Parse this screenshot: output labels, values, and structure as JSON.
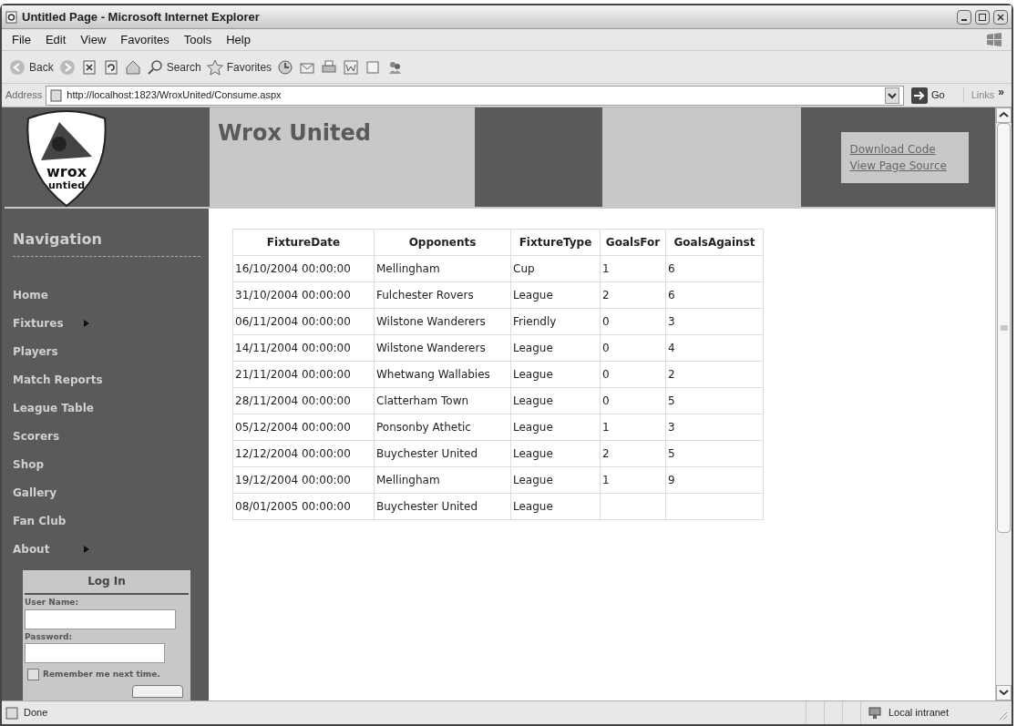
{
  "window": {
    "title": "Untitled Page - Microsoft Internet Explorer"
  },
  "menu": [
    "File",
    "Edit",
    "View",
    "Favorites",
    "Tools",
    "Help"
  ],
  "toolbar": [
    {
      "kind": "back",
      "label": "Back"
    },
    {
      "kind": "forward"
    },
    {
      "kind": "stop"
    },
    {
      "kind": "refresh"
    },
    {
      "kind": "home"
    },
    {
      "kind": "search",
      "label": "Search"
    },
    {
      "kind": "favorites",
      "label": "Favorites"
    },
    {
      "kind": "history"
    },
    {
      "kind": "mail"
    },
    {
      "kind": "print"
    },
    {
      "kind": "edit"
    },
    {
      "kind": "discuss"
    },
    {
      "kind": "messenger"
    }
  ],
  "address_bar": {
    "label": "Address",
    "url": "http://localhost:1823/WroxUnited/Consume.aspx",
    "go": "Go",
    "links": "Links",
    "more": "»"
  },
  "header": {
    "logo_text": [
      "wrox",
      "untied"
    ],
    "site_title": "Wrox United",
    "links": [
      "Download Code",
      "View Page Source"
    ]
  },
  "sidebar": {
    "heading": "Navigation",
    "items": [
      {
        "label": "Home",
        "has_submenu": false
      },
      {
        "label": "Fixtures",
        "has_submenu": true
      },
      {
        "label": "Players",
        "has_submenu": false
      },
      {
        "label": "Match Reports",
        "has_submenu": false
      },
      {
        "label": "League Table",
        "has_submenu": false
      },
      {
        "label": "Scorers",
        "has_submenu": false
      },
      {
        "label": "Shop",
        "has_submenu": false
      },
      {
        "label": "Gallery",
        "has_submenu": false
      },
      {
        "label": "Fan Club",
        "has_submenu": false
      },
      {
        "label": "About",
        "has_submenu": true
      }
    ]
  },
  "login": {
    "title": "Log In",
    "fields": [
      {
        "label": "User Name:"
      },
      {
        "label": "Password:"
      }
    ],
    "remember": {
      "label": "Remember me next time.",
      "checked": false
    }
  },
  "table": {
    "columns": [
      "FixtureDate",
      "Opponents",
      "FixtureType",
      "GoalsFor",
      "GoalsAgainst"
    ],
    "rows": [
      [
        "16/10/2004 00:00:00",
        "Mellingham",
        "Cup",
        "1",
        "6"
      ],
      [
        "31/10/2004 00:00:00",
        "Fulchester Rovers",
        "League",
        "2",
        "6"
      ],
      [
        "06/11/2004 00:00:00",
        "Wilstone Wanderers",
        "Friendly",
        "0",
        "3"
      ],
      [
        "14/11/2004 00:00:00",
        "Wilstone Wanderers",
        "League",
        "0",
        "4"
      ],
      [
        "21/11/2004 00:00:00",
        "Whetwang Wallabies",
        "League",
        "0",
        "2"
      ],
      [
        "28/11/2004 00:00:00",
        "Clatterham Town",
        "League",
        "0",
        "5"
      ],
      [
        "05/12/2004 00:00:00",
        "Ponsonby Athetic",
        "League",
        "1",
        "3"
      ],
      [
        "12/12/2004 00:00:00",
        "Buychester United",
        "League",
        "2",
        "5"
      ],
      [
        "19/12/2004 00:00:00",
        "Mellingham",
        "League",
        "1",
        "9"
      ],
      [
        "08/01/2005 00:00:00",
        "Buychester United",
        "League",
        "",
        ""
      ]
    ]
  },
  "status_bar": {
    "text": "Done",
    "zone": "Local intranet"
  }
}
